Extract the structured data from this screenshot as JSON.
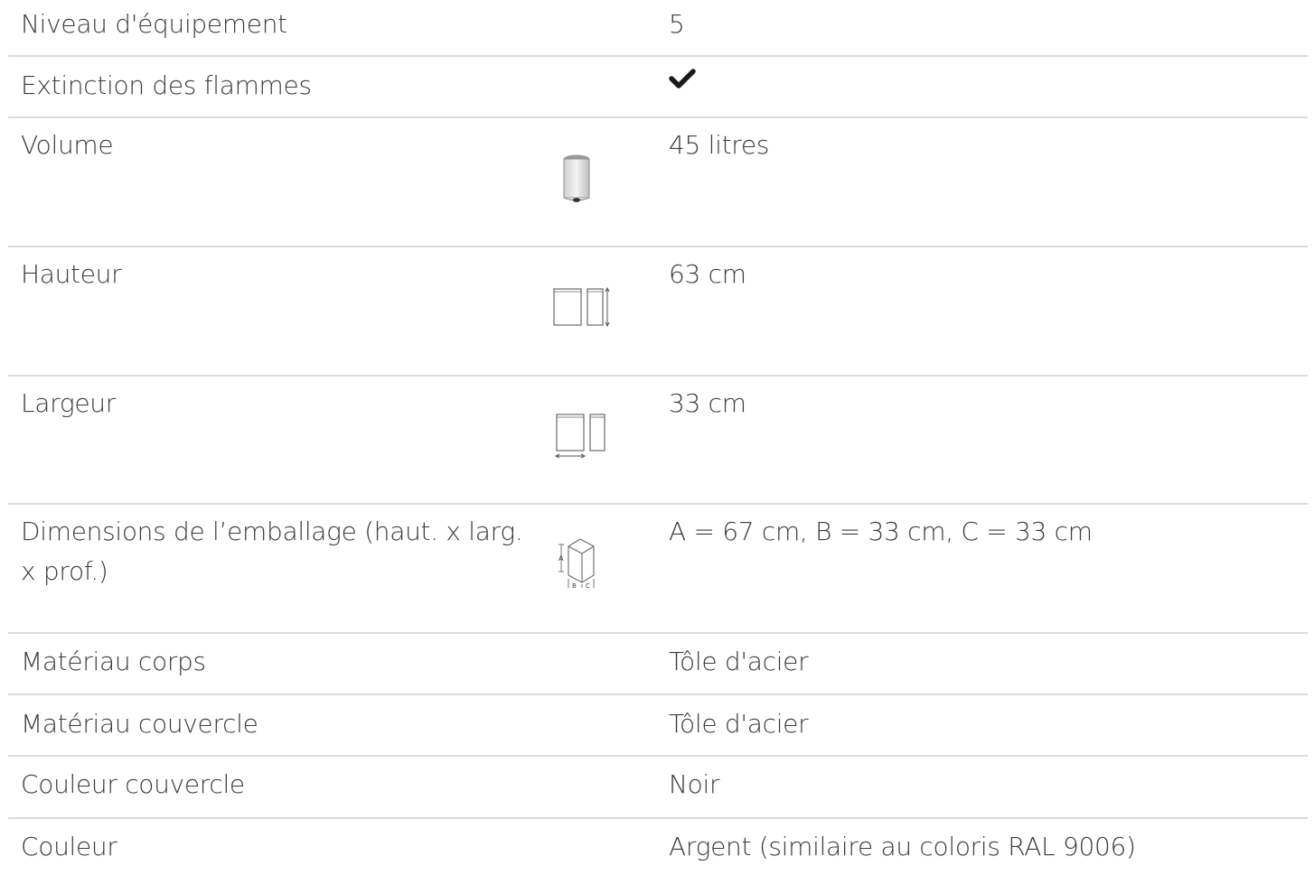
{
  "rows": [
    {
      "label": "Niveau d'équipement",
      "value": "5"
    },
    {
      "label": "Extinction des flammes",
      "value": "",
      "value_icon": "checkmark-icon"
    },
    {
      "label": "Volume",
      "value": "45 litres",
      "icon": "bin-volume-icon"
    },
    {
      "label": "Hauteur",
      "value": "63 cm",
      "icon": "height-dimension-icon"
    },
    {
      "label": "Largeur",
      "value": "33 cm",
      "icon": "width-dimension-icon"
    },
    {
      "label": "Dimensions de l’emballage (haut. x larg. x prof.)",
      "value": "A = 67 cm, B = 33 cm, C = 33 cm",
      "icon": "package-dimensions-icon"
    },
    {
      "label": "Matériau corps",
      "value": "Tôle d'acier"
    },
    {
      "label": "Matériau couvercle",
      "value": "Tôle d'acier"
    },
    {
      "label": "Couleur couvercle",
      "value": "Noir"
    },
    {
      "label": "Couleur",
      "value": "Argent (similaire au coloris RAL 9006)"
    }
  ],
  "icon_labels": {
    "package_a": "A",
    "package_b": "B",
    "package_c": "C"
  },
  "colors": {
    "text": "#3c3c3c",
    "divider": "#dcdcdc",
    "checkmark": "#1a1a1a"
  }
}
